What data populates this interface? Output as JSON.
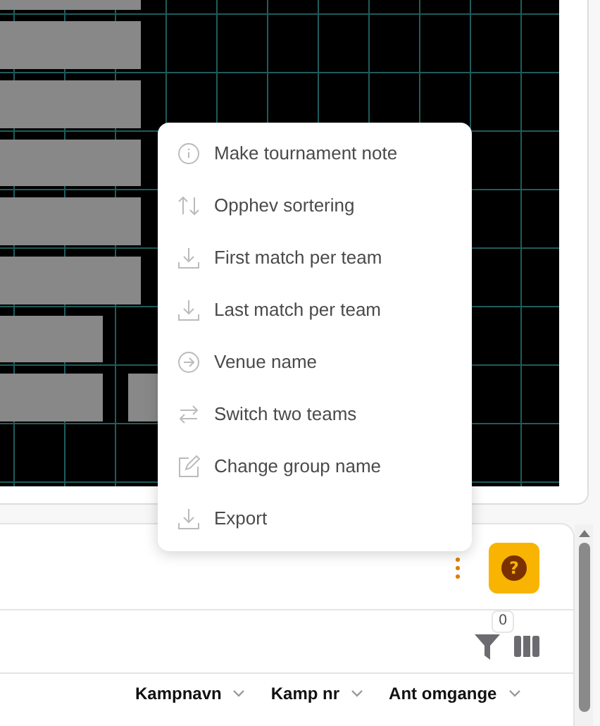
{
  "menu": {
    "items": [
      {
        "kind": "info",
        "label": "Make tournament note"
      },
      {
        "kind": "sort",
        "label": "Opphev sortering"
      },
      {
        "kind": "download",
        "label": "First match per team"
      },
      {
        "kind": "download",
        "label": "Last match per team"
      },
      {
        "kind": "arrow",
        "label": "Venue name"
      },
      {
        "kind": "swap",
        "label": "Switch two teams"
      },
      {
        "kind": "edit",
        "label": "Change group name"
      },
      {
        "kind": "download",
        "label": "Export"
      }
    ]
  },
  "help_button": {
    "label": "?"
  },
  "filter": {
    "count": "0"
  },
  "table": {
    "columns": [
      {
        "label": "Kampnavn"
      },
      {
        "label": "Kamp nr"
      },
      {
        "label": "Ant omgange"
      }
    ]
  }
}
